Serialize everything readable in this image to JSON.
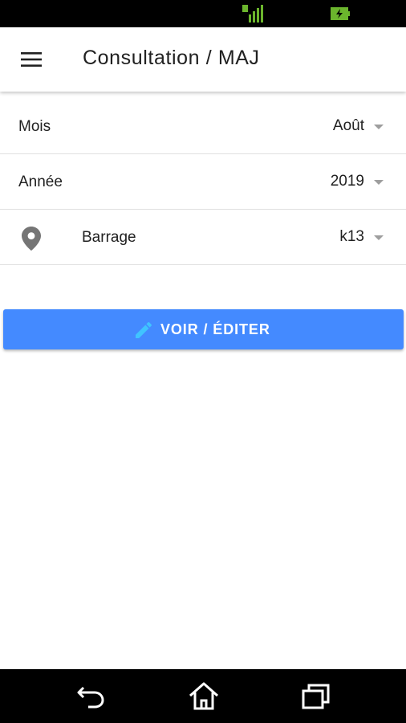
{
  "status_bar": {
    "signal_icon": "signal-icon",
    "battery_icon": "battery-charging-icon",
    "accent_color": "#6bb52d"
  },
  "app_bar": {
    "menu_icon": "hamburger-menu-icon",
    "title": "Consultation / MAJ"
  },
  "form": {
    "month": {
      "label": "Mois",
      "value": "Août"
    },
    "year": {
      "label": "Année",
      "value": "2019"
    },
    "dam": {
      "icon": "location-pin-icon",
      "label": "Barrage",
      "value": "k13"
    }
  },
  "action_button": {
    "icon": "pencil-icon",
    "label": "VOIR / ÉDITER",
    "color": "#448aff"
  },
  "nav_bar": {
    "back_icon": "back-icon",
    "home_icon": "home-icon",
    "recents_icon": "recent-apps-icon"
  }
}
